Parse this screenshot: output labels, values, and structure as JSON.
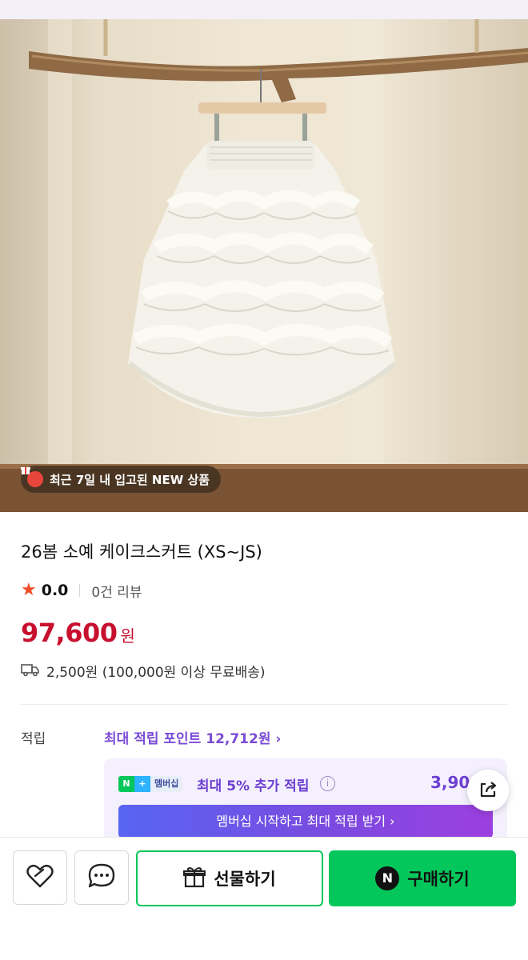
{
  "hero": {
    "new_badge": "최근 7일 내 입고된 NEW 상품",
    "badge_icon": "gift-box-icon"
  },
  "product": {
    "title": "26봄 소예 케이크스커트 (XS~JS)",
    "rating": "0.0",
    "review_count": "0건 리뷰",
    "price": "97,600",
    "price_unit": "원",
    "shipping": "2,500원 (100,000원 이상 무료배송)"
  },
  "points": {
    "label": "적립",
    "max_points_link": "최대 적립 포인트 12,712원 ›",
    "membership": {
      "badge_n": "N",
      "badge_plus": "+",
      "badge_label": "멤버십",
      "text": "최대 5% 추가 적립",
      "info": "i",
      "amount": "3,90",
      "cta": "멤버십 시작하고 최대 적립 받기 ›"
    }
  },
  "actions": {
    "gift_label": "선물하기",
    "buy_label": "구매하기",
    "buy_logo": "N"
  },
  "colors": {
    "price_red": "#c8102e",
    "accent_purple": "#7a4bd6",
    "naver_green": "#03c75a"
  }
}
